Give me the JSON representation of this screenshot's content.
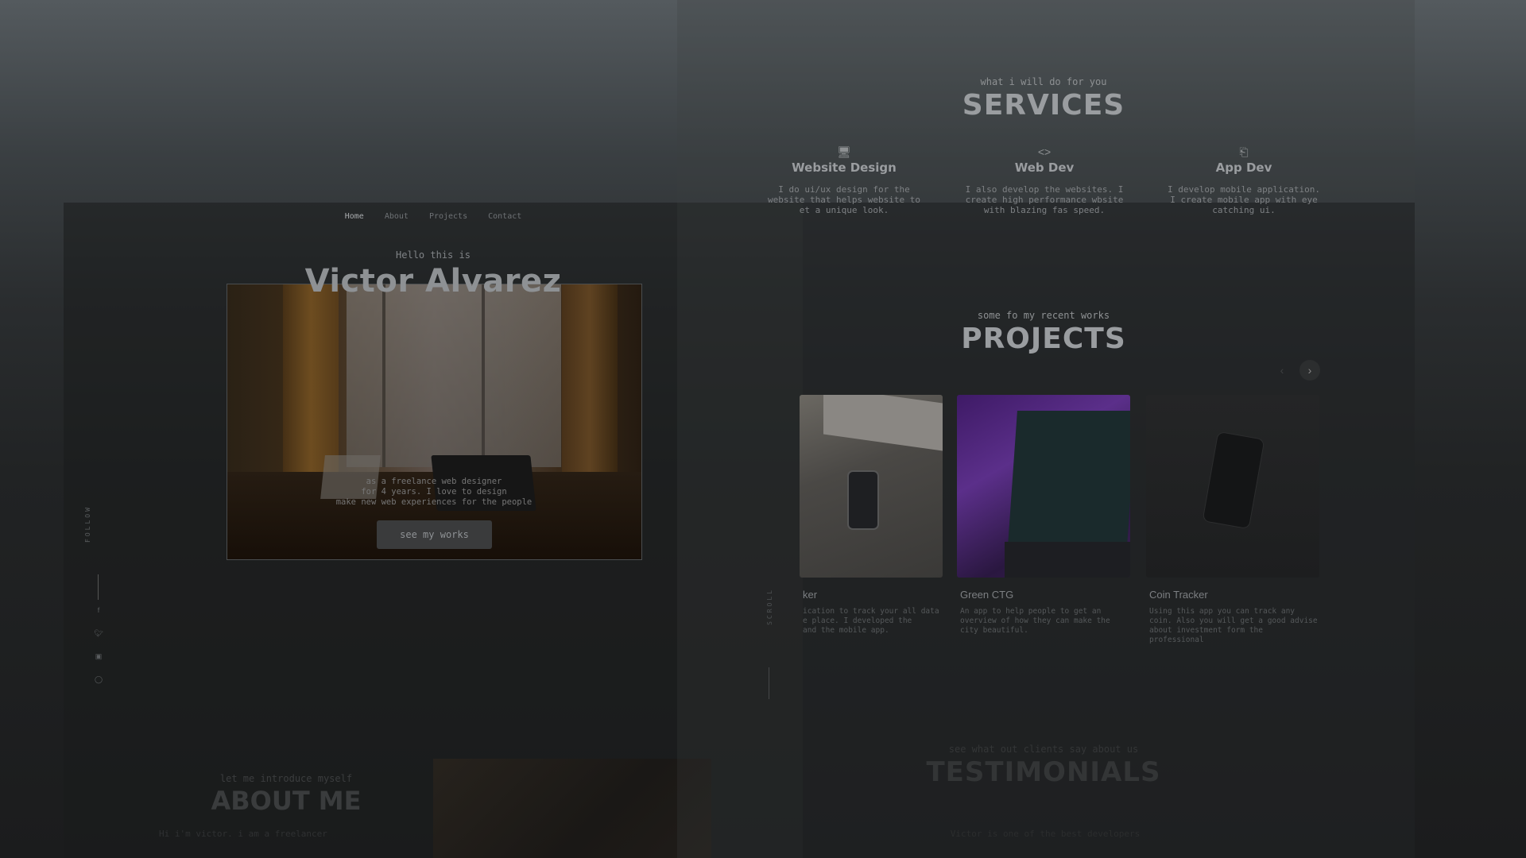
{
  "nav": {
    "home": "Home",
    "about": "About",
    "projects": "Projects",
    "contact": "Contact"
  },
  "hero": {
    "greeting": "Hello this is",
    "name": "Victor Alvarez",
    "intro_line1": "as a freelance web designer",
    "intro_line2": "for 4 years. I love to design",
    "intro_line3": "make new web experiences for the people",
    "button": "see my works"
  },
  "follow": {
    "label": "FOLLOW",
    "icons": [
      "facebook-icon",
      "twitter-icon",
      "instagram-icon",
      "github-icon"
    ]
  },
  "about": {
    "subtitle": "let me introduce myself",
    "title": "ABOUT ME",
    "text": "Hi i'm victor. i am a freelancer"
  },
  "services": {
    "subtitle": "what i will do for you",
    "title": "SERVICES",
    "items": [
      {
        "icon": "monitor-icon",
        "name": "Website Design",
        "line1": "I do ui/ux design for the",
        "line2": "website that helps website to",
        "line3": "et a unique look."
      },
      {
        "icon": "code-icon",
        "name": "Web Dev",
        "line1": "I also develop the websites. I",
        "line2": "create high performance wbsite",
        "line3": "with blazing fas speed."
      },
      {
        "icon": "mobile-app-icon",
        "name": "App Dev",
        "line1": "I develop mobile application.",
        "line2": "I create mobile app with eye",
        "line3": "catching ui."
      }
    ]
  },
  "projects": {
    "subtitle": "some fo my recent works",
    "title": "PROJECTS",
    "items": [
      {
        "title": "ker",
        "line1": "ication to track your all data",
        "line2": "e place. I developed the",
        "line3": "and the mobile app."
      },
      {
        "title": "Green CTG",
        "line1": "An app to help people to get an",
        "line2": "overview of how they can make the",
        "line3": "city beautiful."
      },
      {
        "title": "Coin Tracker",
        "line1": "Using this app you can track any",
        "line2": "coin. Also you will get a good advise",
        "line3": "about investment form the",
        "line4": "professional"
      }
    ],
    "scroll_label": "SCROLL"
  },
  "testimonials": {
    "subtitle": "see what out clients say about us",
    "title": "TESTIMONIALS",
    "text": "Victor is one of the best developers"
  },
  "colors": {
    "background": "#212324",
    "accent": "#9a9da0"
  }
}
